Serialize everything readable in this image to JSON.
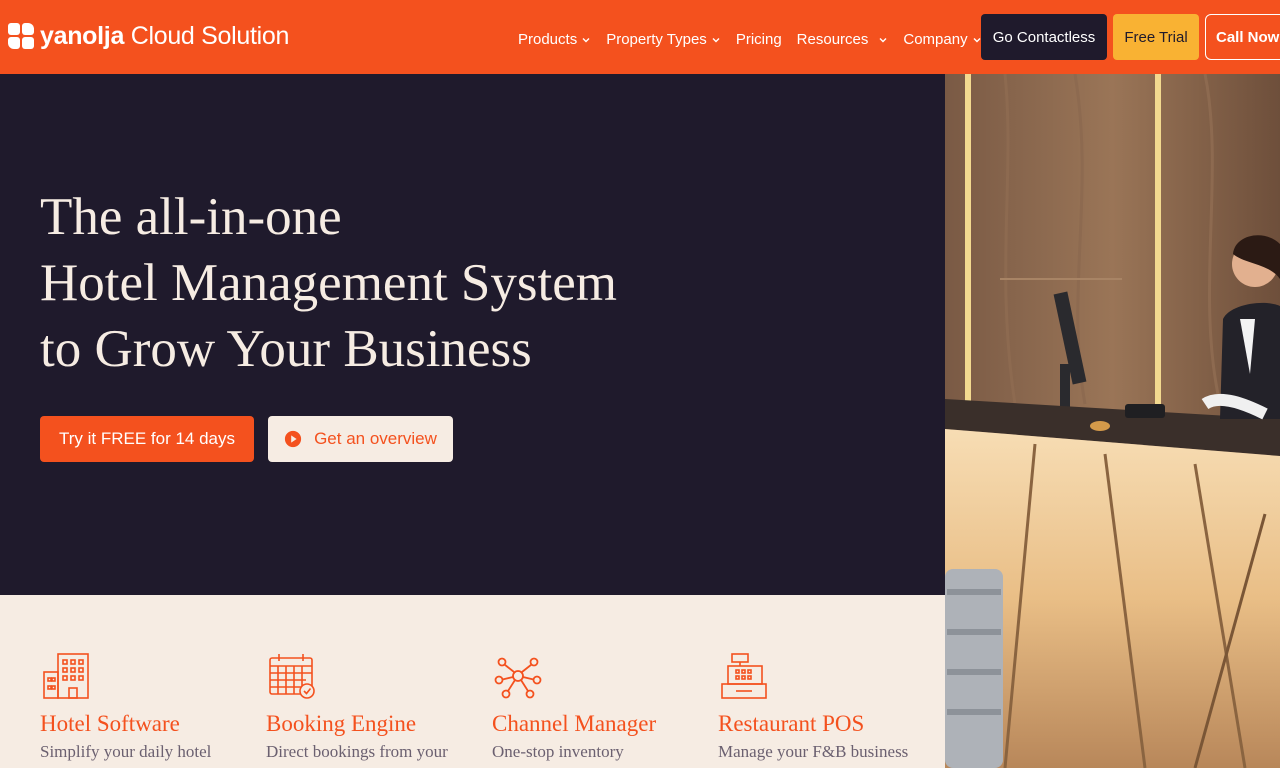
{
  "header": {
    "logo": {
      "brand": "yanolja",
      "product": "Cloud Solution"
    },
    "nav": [
      {
        "label": "Products",
        "has_dropdown": true
      },
      {
        "label": "Property Types",
        "has_dropdown": true
      },
      {
        "label": "Pricing",
        "has_dropdown": false
      },
      {
        "label": "Resources",
        "has_dropdown": true
      },
      {
        "label": "Company",
        "has_dropdown": true
      }
    ],
    "buttons": {
      "contactless": "Go Contactless",
      "trial": "Free Trial",
      "call": "Call Now"
    }
  },
  "hero": {
    "title_lines": [
      "The all-in-one",
      "Hotel Management System",
      "to Grow Your Business"
    ],
    "cta_primary": "Try it FREE for 14 days",
    "cta_secondary": "Get an overview"
  },
  "features": [
    {
      "icon": "building-icon",
      "title": "Hotel Software",
      "description": "Simplify your daily hotel"
    },
    {
      "icon": "calendar-icon",
      "title": "Booking Engine",
      "description": "Direct bookings from your"
    },
    {
      "icon": "network-icon",
      "title": "Channel Manager",
      "description": "One-stop inventory"
    },
    {
      "icon": "cash-register-icon",
      "title": "Restaurant POS",
      "description": "Manage your F&B business"
    }
  ],
  "colors": {
    "brand_orange": "#f4511e",
    "dark_navy": "#1f1a2c",
    "cream": "#f6ece3",
    "yellow": "#f9b233"
  }
}
